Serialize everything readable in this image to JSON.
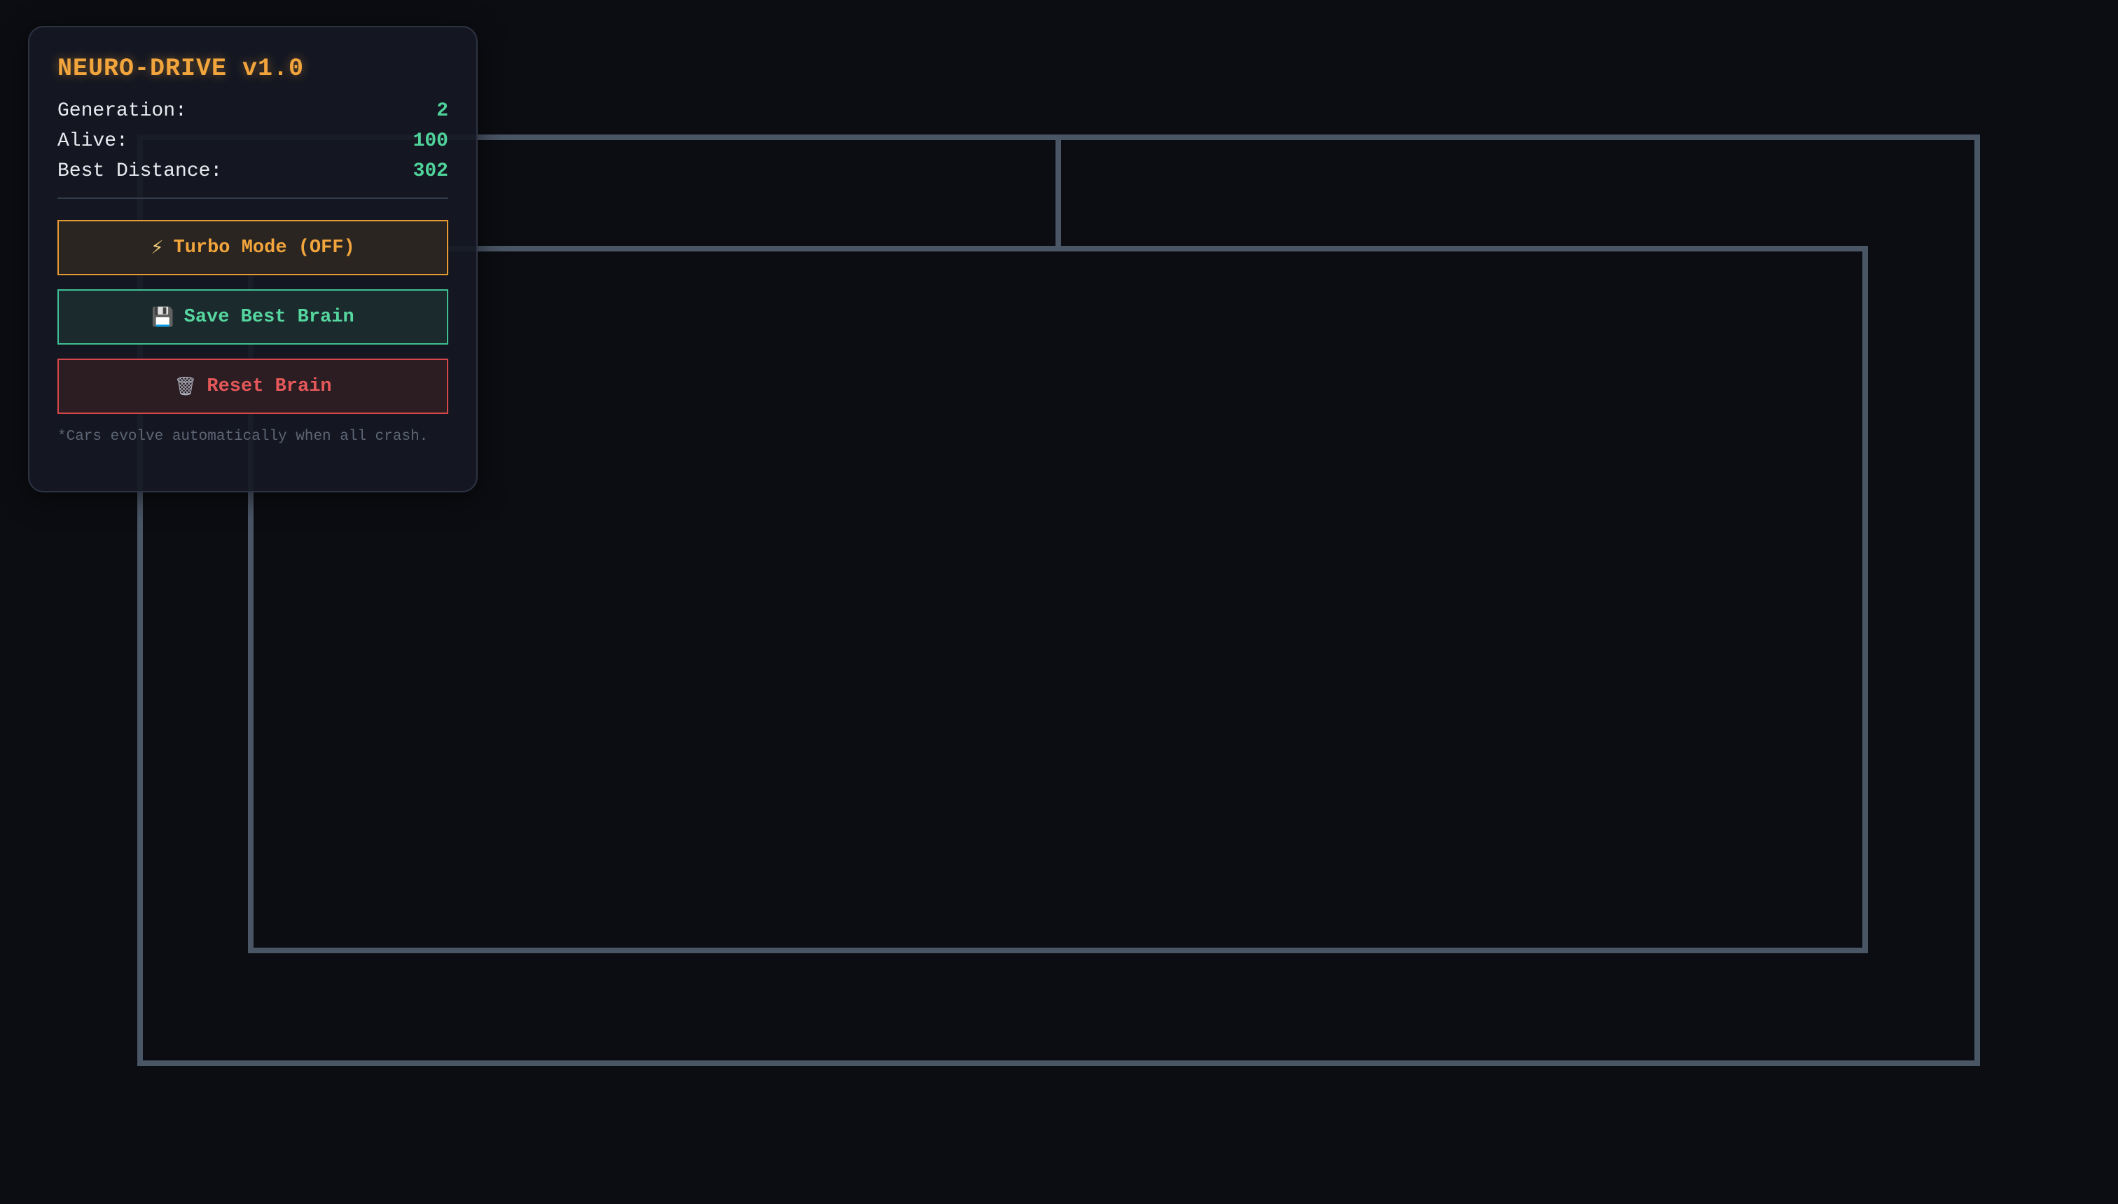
{
  "panel": {
    "title": "NEURO-DRIVE v1.0",
    "stats": [
      {
        "label": "Generation:",
        "value": "2"
      },
      {
        "label": "Alive:",
        "value": "100"
      },
      {
        "label": "Best Distance:",
        "value": "302"
      }
    ],
    "buttons": {
      "turbo": {
        "icon": "lightning-icon",
        "glyph": "⚡",
        "label": "Turbo Mode (OFF)"
      },
      "save": {
        "icon": "floppy-disk-icon",
        "glyph": "💾",
        "label": "Save Best Brain"
      },
      "reset": {
        "icon": "trash-icon",
        "glyph": "🗑",
        "label": "Reset Brain"
      }
    },
    "note": "*Cars evolve automatically when all crash."
  },
  "colors": {
    "background": "#0b0d12",
    "accent": "#f2a53c",
    "value": "#4fd39a",
    "save": "#56d7a0",
    "reset": "#e5585a",
    "wall": "#4a5566"
  }
}
